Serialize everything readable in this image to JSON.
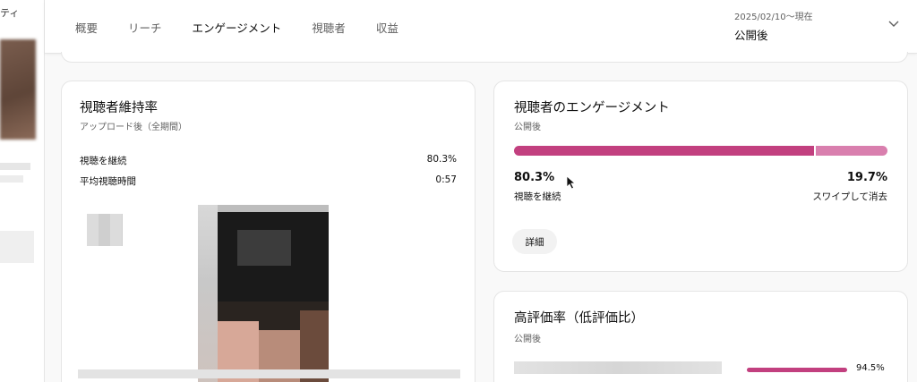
{
  "sidebar": {
    "partial_title": "ティ"
  },
  "header": {
    "tabs": [
      {
        "label": "概要"
      },
      {
        "label": "リーチ"
      },
      {
        "label": "エンゲージメント"
      },
      {
        "label": "視聴者"
      },
      {
        "label": "収益"
      }
    ],
    "active_tab": "エンゲージメント",
    "date_range": {
      "subtitle": "2025/02/10～現在",
      "label": "公開後"
    }
  },
  "retention_card": {
    "title": "視聴者維持率",
    "subtitle": "アップロード後（全期間）",
    "stats": [
      {
        "label": "視聴を継続",
        "value": "80.3%"
      },
      {
        "label": "平均視聴時間",
        "value": "0:57"
      }
    ]
  },
  "engagement_card": {
    "title": "視聴者のエンゲージメント",
    "subtitle": "公開後",
    "continue_fraction": 0.803,
    "continue_pct": "80.3%",
    "continue_label": "視聴を継続",
    "swipe_pct": "19.7%",
    "swipe_label": "スワイプして消去",
    "detail_button": "詳細"
  },
  "likes_card": {
    "title": "高評価率（低評価比）",
    "subtitle": "公開後",
    "like_fraction": 0.945,
    "value": "94.5%"
  },
  "colors": {
    "accent": "#c2407f",
    "accent_light": "#d97fae",
    "chip": "#f2f2f2",
    "border": "#e5e5e5"
  },
  "icons": {
    "date_dropdown": "chevron-down-icon",
    "pointer": "mouse-cursor-icon"
  }
}
